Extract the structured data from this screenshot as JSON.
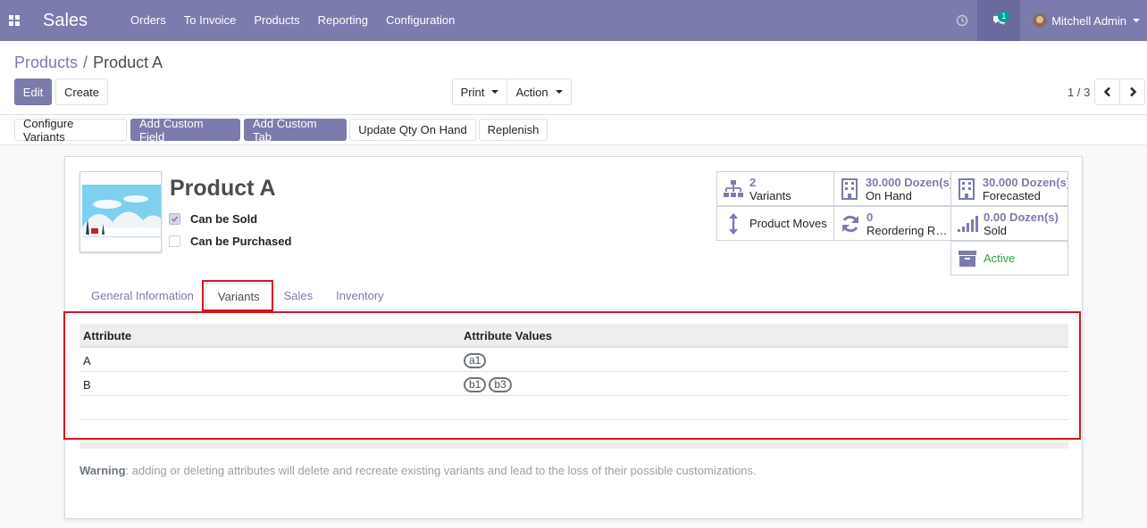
{
  "navbar": {
    "app_name": "Sales",
    "menu": [
      "Orders",
      "To Invoice",
      "Products",
      "Reporting",
      "Configuration"
    ],
    "chat_count": "1",
    "user_name": "Mitchell Admin"
  },
  "breadcrumb": {
    "parent": "Products",
    "separator": "/",
    "current": "Product A"
  },
  "control": {
    "edit_label": "Edit",
    "create_label": "Create",
    "print_label": "Print",
    "action_label": "Action",
    "pager": "1 / 3"
  },
  "header_buttons": [
    "Configure Variants",
    "Add Custom Field",
    "Add Custom Tab",
    "Update Qty On Hand",
    "Replenish"
  ],
  "product": {
    "name": "Product A",
    "can_be_sold_label": "Can be Sold",
    "can_be_sold": true,
    "can_be_purchased_label": "Can be Purchased",
    "can_be_purchased": false
  },
  "smart_buttons": {
    "variants": {
      "value": "2",
      "label": "Variants"
    },
    "on_hand": {
      "value": "30.000",
      "unit": "Dozen(s)",
      "label": "On Hand"
    },
    "forecasted": {
      "value": "30.000",
      "unit": "Dozen(s)",
      "label": "Forecasted"
    },
    "product_moves": {
      "label": "Product Moves"
    },
    "reordering": {
      "value": "0",
      "label": "Reordering Rules"
    },
    "sold": {
      "value": "0.00",
      "unit": "Dozen(s)",
      "label": "Sold"
    },
    "active": {
      "label": "Active"
    }
  },
  "tabs": [
    "General Information",
    "Variants",
    "Sales",
    "Inventory"
  ],
  "active_tab": "Variants",
  "table": {
    "headers": [
      "Attribute",
      "Attribute Values"
    ],
    "rows": [
      {
        "attribute": "A",
        "values": [
          "a1"
        ]
      },
      {
        "attribute": "B",
        "values": [
          "b1",
          "b3"
        ]
      }
    ]
  },
  "warning": {
    "bold": "Warning",
    "text": ": adding or deleting attributes will delete and recreate existing variants and lead to the loss of their possible customizations."
  },
  "colors": {
    "brand": "#7c7bad",
    "highlight": "#d9121e",
    "active_status": "#28a745"
  }
}
